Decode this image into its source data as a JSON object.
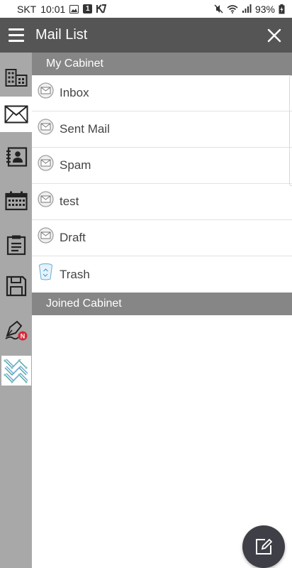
{
  "status_bar": {
    "carrier": "SKT",
    "time": "10:01",
    "notification_badge": "1",
    "battery": "93%"
  },
  "app_bar": {
    "title": "Mail List",
    "menu_icon": "hamburger-menu-icon",
    "close_icon": "close-icon"
  },
  "rail": {
    "items": [
      {
        "icon": "organization-icon",
        "active": false
      },
      {
        "icon": "mail-icon",
        "active": true
      },
      {
        "icon": "contacts-icon",
        "active": false
      },
      {
        "icon": "calendar-icon",
        "active": false
      },
      {
        "icon": "board-icon",
        "active": false
      },
      {
        "icon": "archive-icon",
        "active": false
      },
      {
        "icon": "approval-icon",
        "active": false,
        "badge": "N"
      },
      {
        "icon": "network-app-icon",
        "active": false
      }
    ]
  },
  "my_cabinet": {
    "header": "My Cabinet",
    "folders": [
      {
        "label": "Inbox",
        "icon": "envelope-icon"
      },
      {
        "label": "Sent Mail",
        "icon": "envelope-icon"
      },
      {
        "label": "Spam",
        "icon": "envelope-icon"
      },
      {
        "label": "test",
        "icon": "envelope-icon"
      },
      {
        "label": "Draft",
        "icon": "envelope-icon"
      },
      {
        "label": "Trash",
        "icon": "trash-icon"
      }
    ]
  },
  "joined_cabinet": {
    "header": "Joined Cabinet"
  },
  "fab": {
    "icon": "compose-icon"
  },
  "colors": {
    "app_bar": "#555555",
    "rail": "#a8a8a8",
    "section_header": "#868686",
    "fab": "#3f3f47"
  }
}
